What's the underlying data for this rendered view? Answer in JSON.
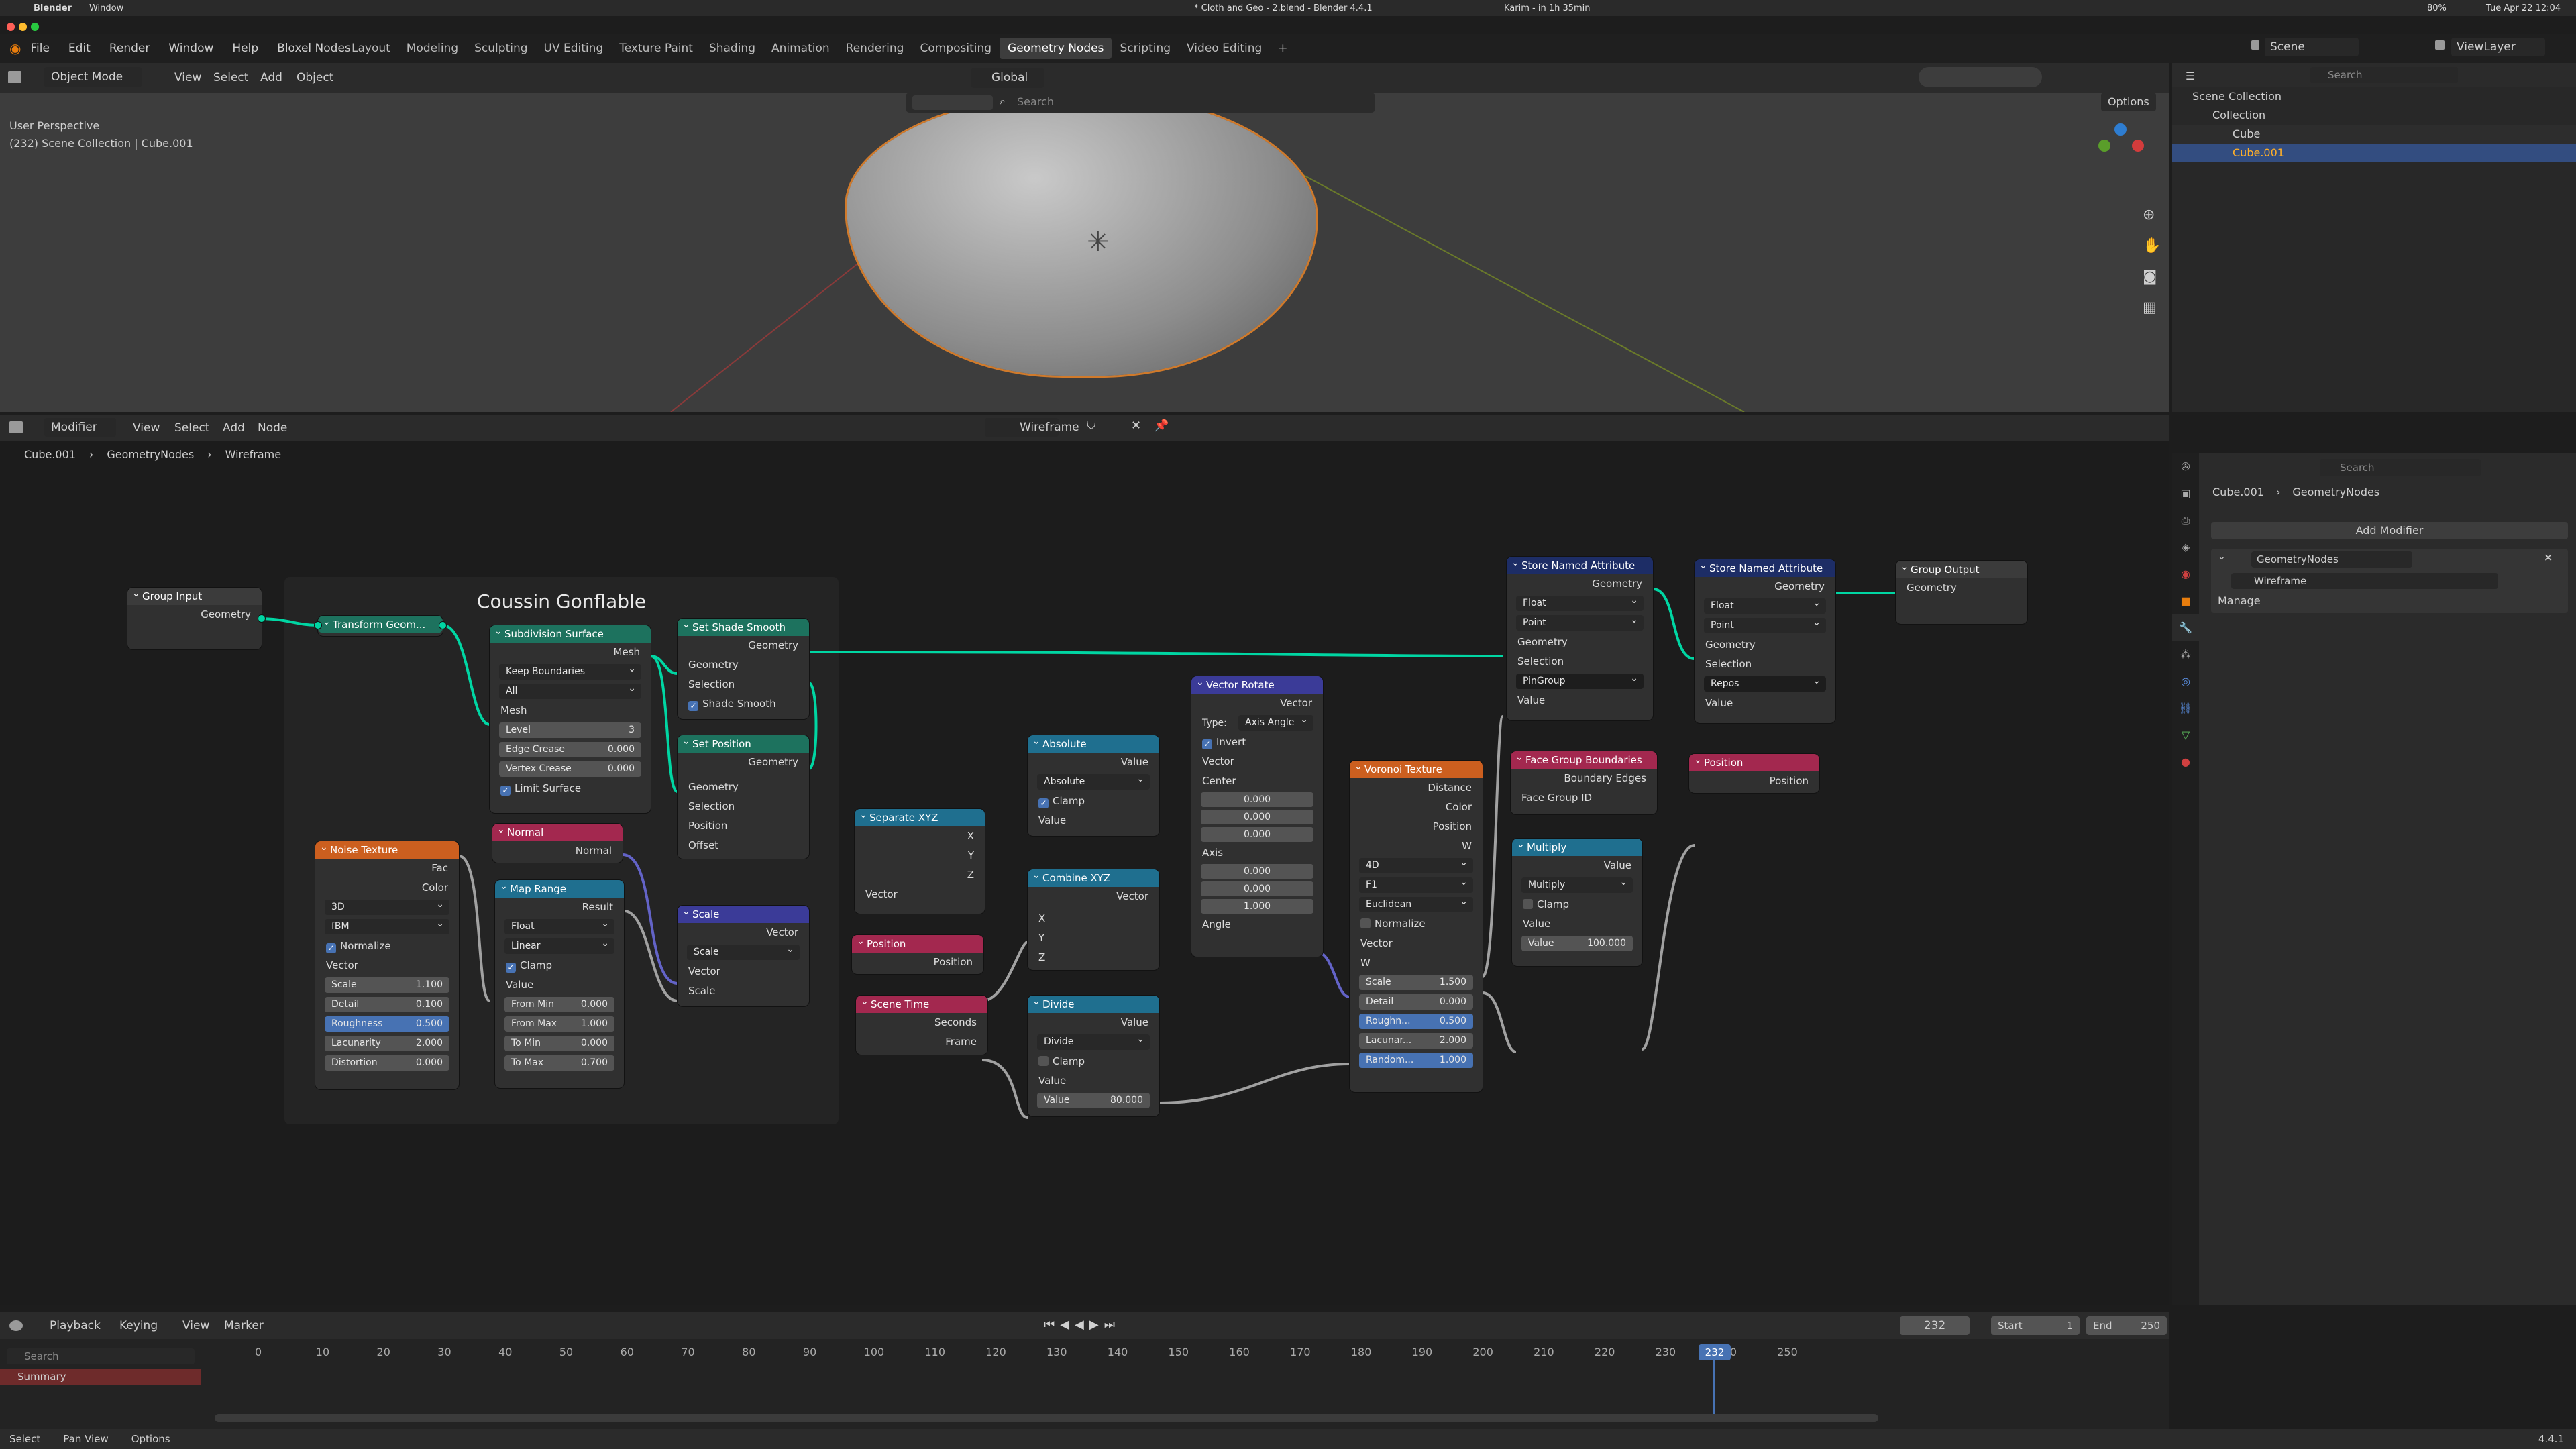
{
  "os_menubar": {
    "app": "Blender",
    "menu": "Window",
    "title": "* Cloth and Geo - 2.blend - Blender 4.4.1",
    "user": "Karim - in 1h 35min",
    "clock": "Tue Apr 22 12:04",
    "battery": "80%"
  },
  "menu": [
    "File",
    "Edit",
    "Render",
    "Window",
    "Help",
    "Bloxel Nodes"
  ],
  "workspaces": [
    "Layout",
    "Modeling",
    "Sculpting",
    "UV Editing",
    "Texture Paint",
    "Shading",
    "Animation",
    "Rendering",
    "Compositing",
    "Geometry Nodes",
    "Scripting",
    "Video Editing"
  ],
  "active_workspace": "Geometry Nodes",
  "scene": "Scene",
  "view_layer": "ViewLayer",
  "viewport": {
    "mode": "Object Mode",
    "menus": [
      "View",
      "Select",
      "Add",
      "Object"
    ],
    "orientation": "Global",
    "search_placeholder": "Search",
    "options": "Options",
    "perspective": "User Perspective",
    "collection_info": "(232) Scene Collection | Cube.001"
  },
  "outliner": {
    "search_placeholder": "Search",
    "items": [
      {
        "label": "Scene Collection",
        "level": 0
      },
      {
        "label": "Collection",
        "level": 1
      },
      {
        "label": "Cube",
        "level": 2
      },
      {
        "label": "Cube.001",
        "level": 2
      }
    ]
  },
  "node_editor": {
    "editor_type": "Modifier",
    "menus": [
      "View",
      "Select",
      "Add",
      "Node"
    ],
    "tree_name": "Wireframe",
    "breadcrumb": [
      "Cube.001",
      "GeometryNodes",
      "Wireframe"
    ],
    "frame_label": "Coussin Gonflable"
  },
  "nodes": {
    "group_input": {
      "title": "Group Input",
      "geometry": "Geometry"
    },
    "transform": {
      "title": "Transform Geom..."
    },
    "subdiv": {
      "title": "Subdivision Surface",
      "mesh_out": "Mesh",
      "boundary": "Keep Boundaries",
      "uv": "All",
      "mesh_in": "Mesh",
      "level_label": "Level",
      "level": "3",
      "edge_label": "Edge Crease",
      "edge": "0.000",
      "vertex_label": "Vertex Crease",
      "vertex": "0.000",
      "limit": "Limit Surface"
    },
    "shade_smooth": {
      "title": "Set Shade Smooth",
      "geo_out": "Geometry",
      "geo_in": "Geometry",
      "sel": "Selection",
      "smooth": "Shade Smooth"
    },
    "set_pos": {
      "title": "Set Position",
      "geo_out": "Geometry",
      "geo_in": "Geometry",
      "sel": "Selection",
      "pos": "Position",
      "offset": "Offset"
    },
    "noise": {
      "title": "Noise Texture",
      "fac": "Fac",
      "color": "Color",
      "dim": "3D",
      "type": "fBM",
      "normalize": "Normalize",
      "vector": "Vector",
      "scale_l": "Scale",
      "scale": "1.100",
      "detail_l": "Detail",
      "detail": "0.100",
      "rough_l": "Roughness",
      "rough": "0.500",
      "lac_l": "Lacunarity",
      "lac": "2.000",
      "dist_l": "Distortion",
      "dist": "0.000"
    },
    "normal": {
      "title": "Normal",
      "out": "Normal"
    },
    "map_range": {
      "title": "Map Range",
      "result": "Result",
      "dtype": "Float",
      "interp": "Linear",
      "clamp": "Clamp",
      "value": "Value",
      "fmin_l": "From Min",
      "fmin": "0.000",
      "fmax_l": "From Max",
      "fmax": "1.000",
      "tmin_l": "To Min",
      "tmin": "0.000",
      "tmax_l": "To Max",
      "tmax": "0.700"
    },
    "scale": {
      "title": "Scale",
      "out": "Vector",
      "op": "Scale",
      "vector": "Vector",
      "scale": "Scale"
    },
    "sep_xyz": {
      "title": "Separate XYZ",
      "x": "X",
      "y": "Y",
      "z": "Z",
      "vector": "Vector"
    },
    "position1": {
      "title": "Position",
      "out": "Position"
    },
    "scene_time": {
      "title": "Scene Time",
      "seconds": "Seconds",
      "frame": "Frame"
    },
    "absolute": {
      "title": "Absolute",
      "out": "Value",
      "op": "Absolute",
      "clamp": "Clamp",
      "value": "Value"
    },
    "combine": {
      "title": "Combine XYZ",
      "out": "Vector",
      "x": "X",
      "y": "Y",
      "z": "Z"
    },
    "divide": {
      "title": "Divide",
      "out": "Value",
      "op": "Divide",
      "clamp": "Clamp",
      "value": "Value",
      "value2_l": "Value",
      "value2": "80.000"
    },
    "vrot": {
      "title": "Vector Rotate",
      "out": "Vector",
      "type_l": "Type:",
      "type": "Axis Angle",
      "invert": "Invert",
      "vector": "Vector",
      "center": "Center",
      "c1": "0.000",
      "c2": "0.000",
      "c3": "0.000",
      "axis": "Axis",
      "a1": "0.000",
      "a2": "0.000",
      "a3": "1.000",
      "angle": "Angle"
    },
    "voronoi": {
      "title": "Voronoi Texture",
      "distance": "Distance",
      "color": "Color",
      "position": "Position",
      "w": "W",
      "dim": "4D",
      "feature": "F1",
      "metric": "Euclidean",
      "normalize": "Normalize",
      "vector": "Vector",
      "w_in": "W",
      "scale_l": "Scale",
      "scale": "1.500",
      "detail_l": "Detail",
      "detail": "0.000",
      "rough_l": "Roughn...",
      "rough": "0.500",
      "lac_l": "Lacunar...",
      "lac": "2.000",
      "rand_l": "Random...",
      "rand": "1.000"
    },
    "store1": {
      "title": "Store Named Attribute",
      "geo_out": "Geometry",
      "dtype": "Float",
      "domain": "Point",
      "geo_in": "Geometry",
      "sel": "Selection",
      "name": "PinGroup",
      "value": "Value"
    },
    "store2": {
      "title": "Store Named Attribute",
      "geo_out": "Geometry",
      "dtype": "Float",
      "domain": "Point",
      "geo_in": "Geometry",
      "sel": "Selection",
      "name": "Repos",
      "value": "Value"
    },
    "group_output": {
      "title": "Group Output",
      "geometry": "Geometry"
    },
    "face_group": {
      "title": "Face Group Boundaries",
      "out": "Boundary Edges",
      "in": "Face Group ID"
    },
    "multiply": {
      "title": "Multiply",
      "out": "Value",
      "op": "Multiply",
      "clamp": "Clamp",
      "value": "Value",
      "value2_l": "Value",
      "value2": "100.000"
    },
    "position2": {
      "title": "Position",
      "out": "Position"
    }
  },
  "properties": {
    "search_placeholder": "Search",
    "breadcrumb": [
      "Cube.001",
      "GeometryNodes"
    ],
    "add_modifier": "Add Modifier",
    "modifier_name": "GeometryNodes",
    "node_group": "Wireframe",
    "manage": "Manage"
  },
  "timeline": {
    "menus": [
      "Playback",
      "Keying",
      "View",
      "Marker"
    ],
    "current_frame": "232",
    "start_l": "Start",
    "start": "1",
    "end_l": "End",
    "end": "250",
    "ticks": [
      "0",
      "10",
      "20",
      "30",
      "40",
      "50",
      "60",
      "70",
      "80",
      "90",
      "100",
      "110",
      "120",
      "130",
      "140",
      "150",
      "160",
      "170",
      "180",
      "190",
      "200",
      "210",
      "220",
      "230",
      "240",
      "250"
    ],
    "search_placeholder": "Search",
    "summary": "Summary"
  },
  "status": {
    "select": "Select",
    "pan": "Pan View",
    "options": "Options",
    "version": "4.4.1"
  },
  "colors": {
    "geometry": "#00d6a3",
    "vector": "#6363c7",
    "float": "#a1a1a1",
    "accent": "#4772b3"
  }
}
